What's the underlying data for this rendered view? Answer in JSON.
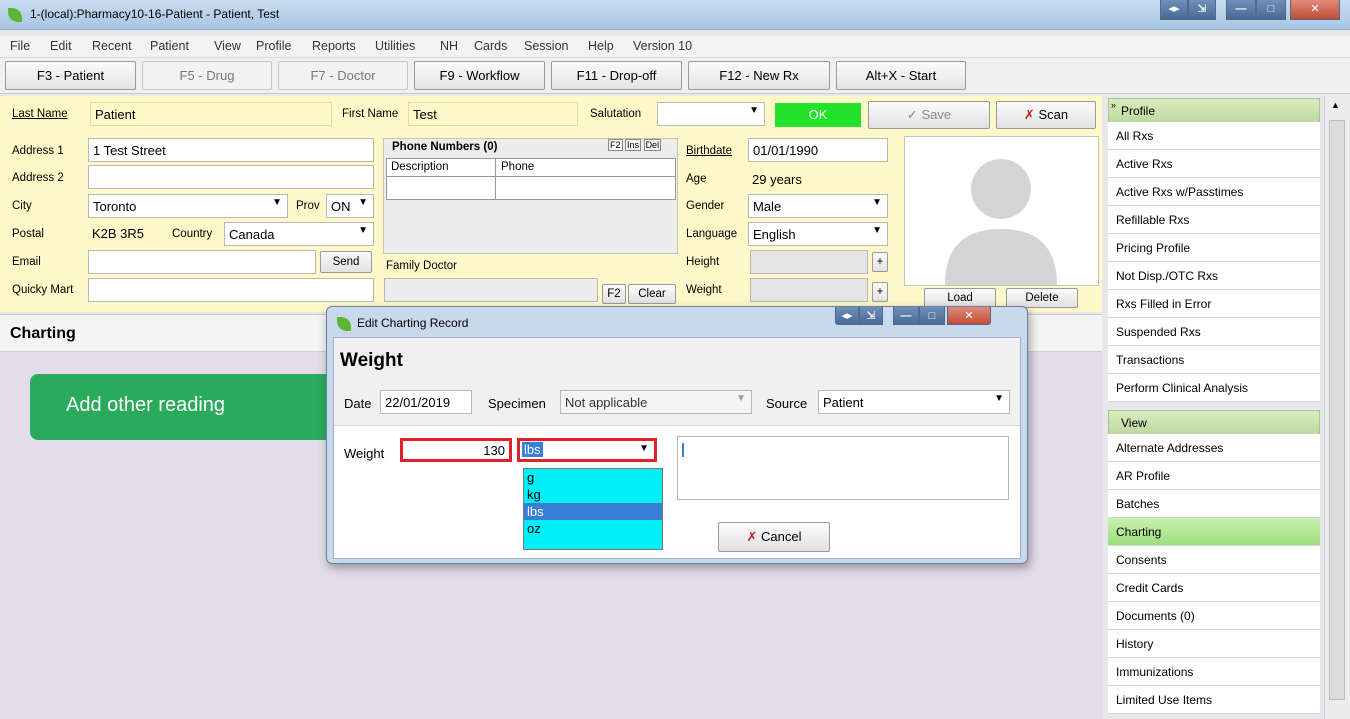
{
  "window": {
    "title": "1-(local):Pharmacy10-16-Patient - Patient, Test"
  },
  "menu": [
    "File",
    "Edit",
    "Recent",
    "Patient",
    "View",
    "Profile",
    "Reports",
    "Utilities",
    "NH",
    "Cards",
    "Session",
    "Help",
    "Version 10"
  ],
  "fkeys": [
    {
      "label": "F3 - Patient",
      "enabled": true
    },
    {
      "label": "F5 - Drug",
      "enabled": false
    },
    {
      "label": "F7 - Doctor",
      "enabled": false
    },
    {
      "label": "F9 - Workflow",
      "enabled": true
    },
    {
      "label": "F11 - Drop-off",
      "enabled": true
    },
    {
      "label": "F12 - New Rx",
      "enabled": true
    },
    {
      "label": "Alt+X - Start",
      "enabled": true
    }
  ],
  "patient": {
    "last_name_label": "Last Name",
    "last_name": "Patient",
    "first_name_label": "First Name",
    "first_name": "Test",
    "salutation_label": "Salutation",
    "salutation": "",
    "ok_label": "OK",
    "save_label": "Save",
    "scan_label": "Scan",
    "address1_label": "Address 1",
    "address1": "1 Test Street",
    "address2_label": "Address 2",
    "address2": "",
    "city_label": "City",
    "city": "Toronto",
    "prov_label": "Prov",
    "prov": "ON",
    "postal_label": "Postal",
    "postal": "K2B 3R5",
    "country_label": "Country",
    "country": "Canada",
    "email_label": "Email",
    "email": "",
    "send_label": "Send",
    "quicky_label": "Quicky Mart",
    "quicky": "",
    "phone_title": "Phone Numbers (0)",
    "phone_col_desc": "Description",
    "phone_col_phone": "Phone",
    "phone_btns": [
      "F2",
      "Ins",
      "Del"
    ],
    "family_doctor_label": "Family Doctor",
    "f2_label": "F2",
    "clear_label": "Clear",
    "birthdate_label": "Birthdate",
    "birthdate": "01/01/1990",
    "age_label": "Age",
    "age": "29 years",
    "gender_label": "Gender",
    "gender": "Male",
    "language_label": "Language",
    "language": "English",
    "height_label": "Height",
    "weight_label": "Weight",
    "load_label": "Load",
    "delete_label": "Delete"
  },
  "charting": {
    "header": "Charting",
    "add_reading": "Add other reading"
  },
  "sidebar": {
    "profile_header": "Profile",
    "profile_items": [
      "All Rxs",
      "Active Rxs",
      "Active Rxs w/Passtimes",
      "Refillable Rxs",
      "Pricing Profile",
      "Not Disp./OTC Rxs",
      "Rxs Filled in Error",
      "Suspended Rxs",
      "Transactions",
      "Perform Clinical Analysis"
    ],
    "view_header": "View",
    "view_items": [
      "Alternate Addresses",
      "AR Profile",
      "Batches",
      "Charting",
      "Consents",
      "Credit Cards",
      "Documents (0)",
      "History",
      "Immunizations",
      "Limited Use Items"
    ],
    "active_item": "Charting"
  },
  "dialog": {
    "title": "Edit Charting Record",
    "heading": "Weight",
    "date_label": "Date",
    "date": "22/01/2019",
    "specimen_label": "Specimen",
    "specimen": "Not applicable",
    "source_label": "Source",
    "source": "Patient",
    "weight_label": "Weight",
    "weight_value": "130",
    "unit_selected": "lbs",
    "unit_options": [
      "g",
      "kg",
      "lbs",
      "oz"
    ],
    "cancel_label": "Cancel"
  }
}
